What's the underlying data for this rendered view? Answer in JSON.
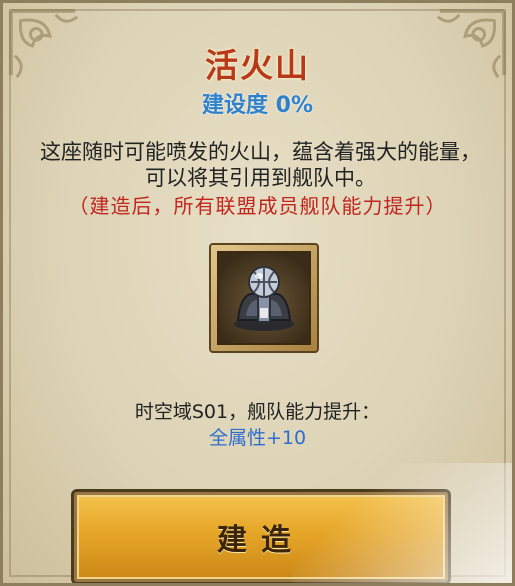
{
  "building": {
    "name": "活火山",
    "progress": "建设度 0%",
    "description": "这座随时可能喷发的火山，蕴含着强大的能量，可以将其引用到舰队中。",
    "bonus_note": "（建造后，所有联盟成员舰队能力提升）",
    "icon": "volcano-tower-icon"
  },
  "effect": {
    "location": "时空域S01，舰队能力提升：",
    "attribute": "全属性+10"
  },
  "actions": {
    "build_label": "建造"
  },
  "colors": {
    "title": "#b8391a",
    "progress": "#2f82c9",
    "bonus_note": "#c2251e",
    "attribute": "#2f6ed0",
    "button": "#e6a628"
  }
}
